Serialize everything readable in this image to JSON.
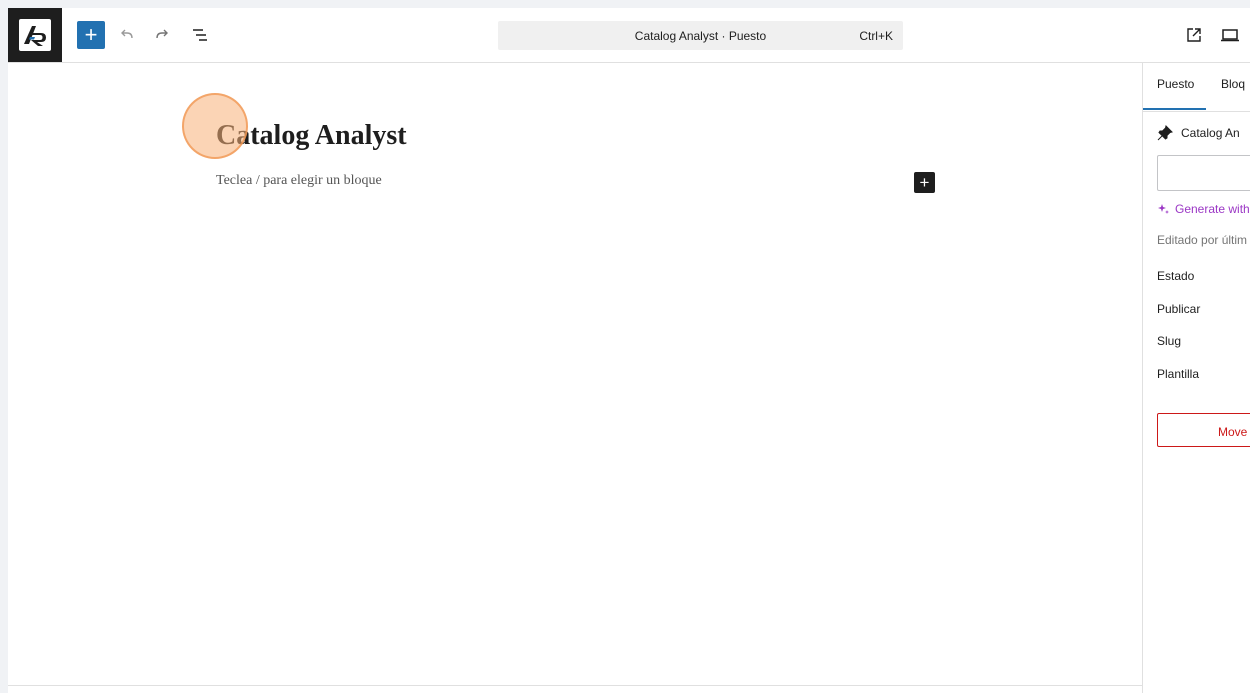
{
  "toolbar": {
    "add_label": "+",
    "command_title": "Catalog Analyst · Puesto",
    "command_shortcut": "Ctrl+K"
  },
  "editor": {
    "post_title": "Catalog Analyst",
    "block_placeholder": "Teclea / para elegir un bloque",
    "inserter_label": "+"
  },
  "sidebar": {
    "tabs": [
      {
        "label": "Puesto"
      },
      {
        "label": "Bloq"
      }
    ],
    "post_name": "Catalog An",
    "generate_label": "Generate with",
    "edited_text": "Editado por últim",
    "rows": [
      {
        "label": "Estado"
      },
      {
        "label": "Publicar"
      },
      {
        "label": "Slug"
      },
      {
        "label": "Plantilla"
      }
    ],
    "trash_label": "Move"
  },
  "colors": {
    "accent": "#2271b1",
    "danger": "#cc1818",
    "ai": "#9b37c5",
    "click_highlight": "#f7b078"
  }
}
